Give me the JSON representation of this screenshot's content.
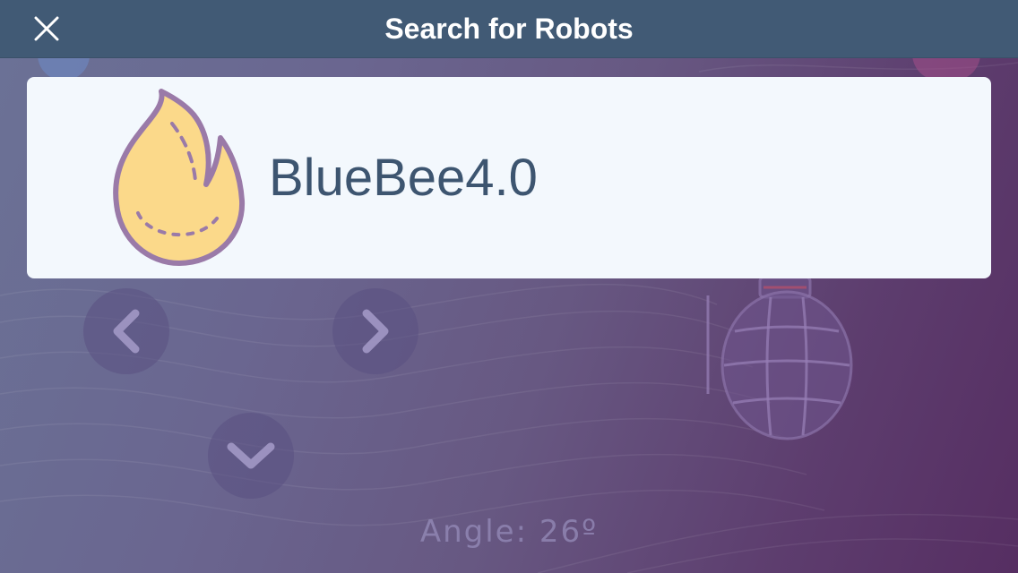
{
  "navbar": {
    "title": "Search for Robots",
    "close_icon": "close-icon"
  },
  "robots": [
    {
      "name": "BlueBee4.0",
      "icon": "flame-icon"
    }
  ],
  "background": {
    "angle_label": "Angle: 26º",
    "controls": [
      "chevron-left-icon",
      "chevron-right-icon",
      "chevron-down-icon",
      "grenade-icon"
    ]
  },
  "colors": {
    "navbar": "#415a75",
    "card": "#f3f8fd",
    "robot_name": "#3d5570",
    "flame_fill": "#fbd98a",
    "flame_stroke": "#9a7aa8"
  }
}
